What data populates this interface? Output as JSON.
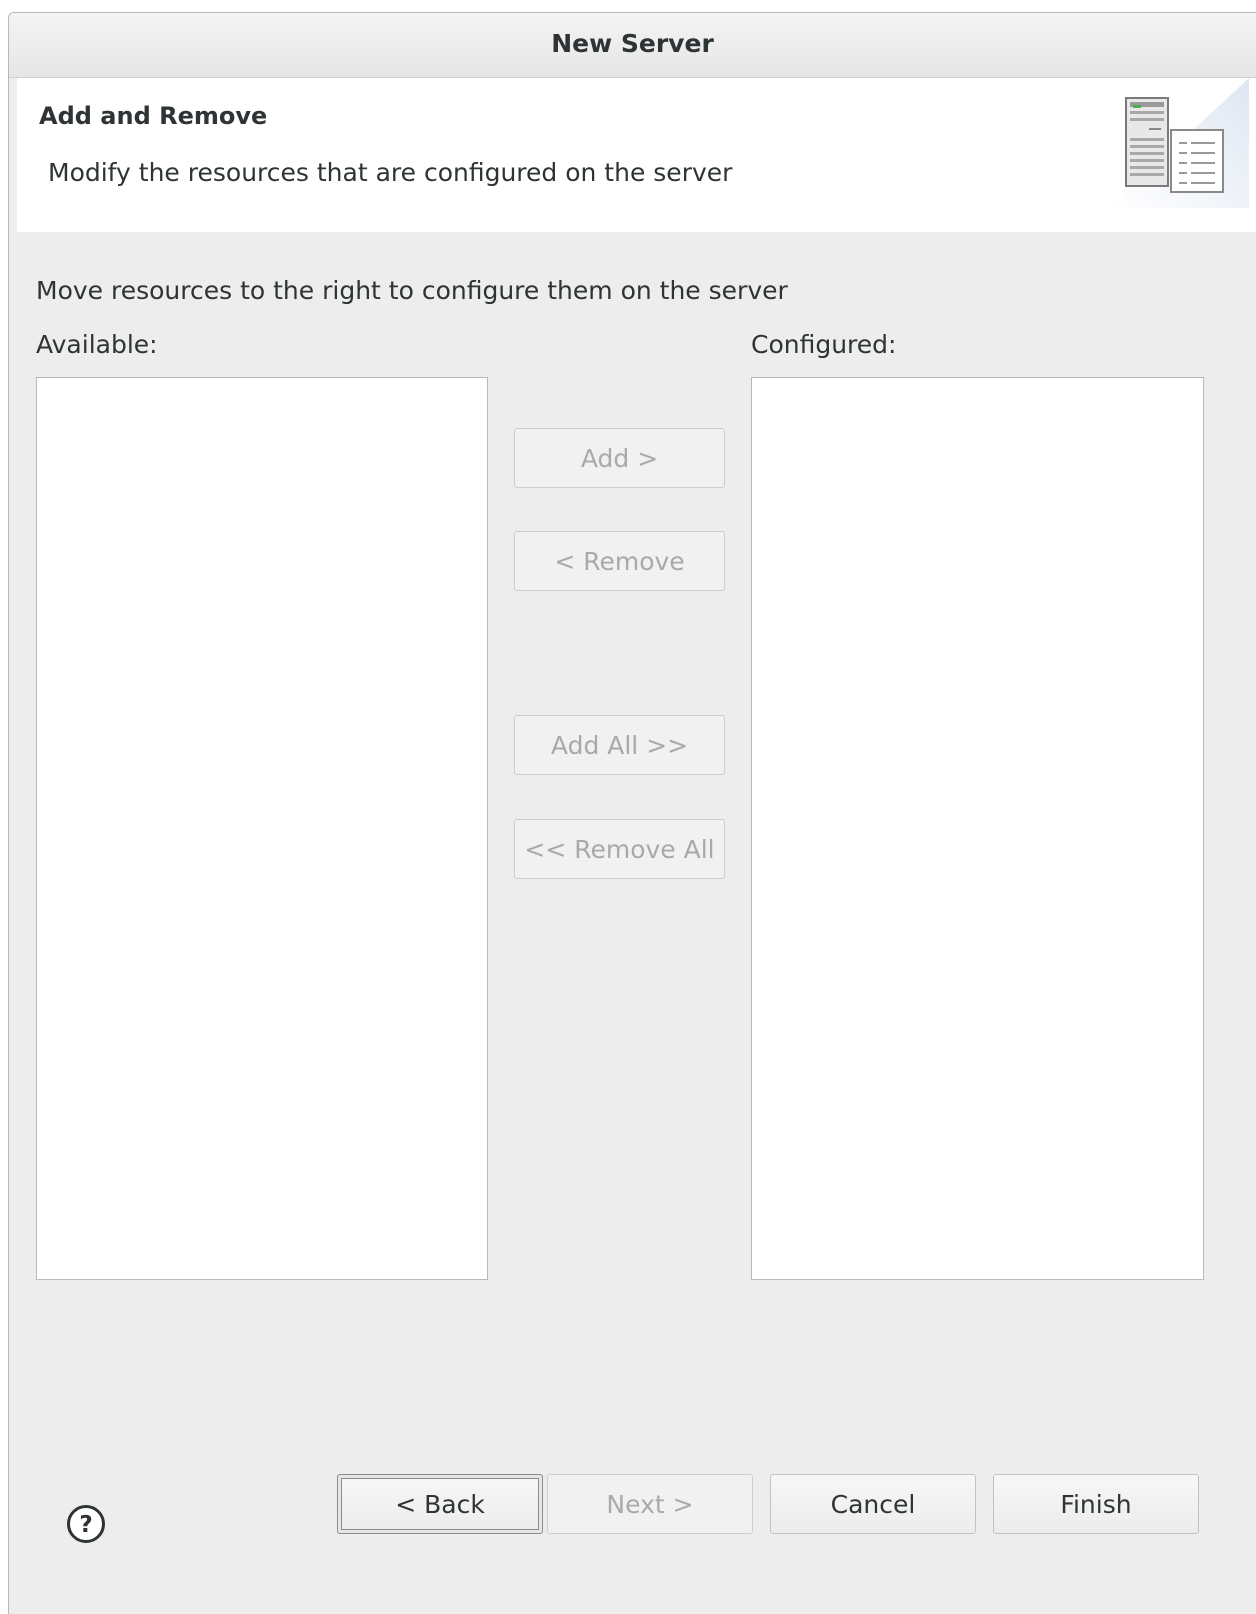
{
  "window": {
    "title": "New Server"
  },
  "banner": {
    "title": "Add and Remove",
    "description": "Modify the resources that are configured on the server",
    "icon": "server-icon"
  },
  "instruction": "Move resources to the right to configure them on the server",
  "available": {
    "label": "Available:",
    "items": []
  },
  "configured": {
    "label": "Configured:",
    "items": []
  },
  "transfer": {
    "add": "Add >",
    "remove": "< Remove",
    "add_all": "Add All >>",
    "remove_all": "<< Remove All"
  },
  "footer": {
    "help_icon": "help-icon",
    "back": "< Back",
    "next": "Next >",
    "cancel": "Cancel",
    "finish": "Finish"
  },
  "colors": {
    "dialog_bg": "#ededed",
    "disabled_text": "#a9a9a9",
    "text": "#2e3436"
  }
}
